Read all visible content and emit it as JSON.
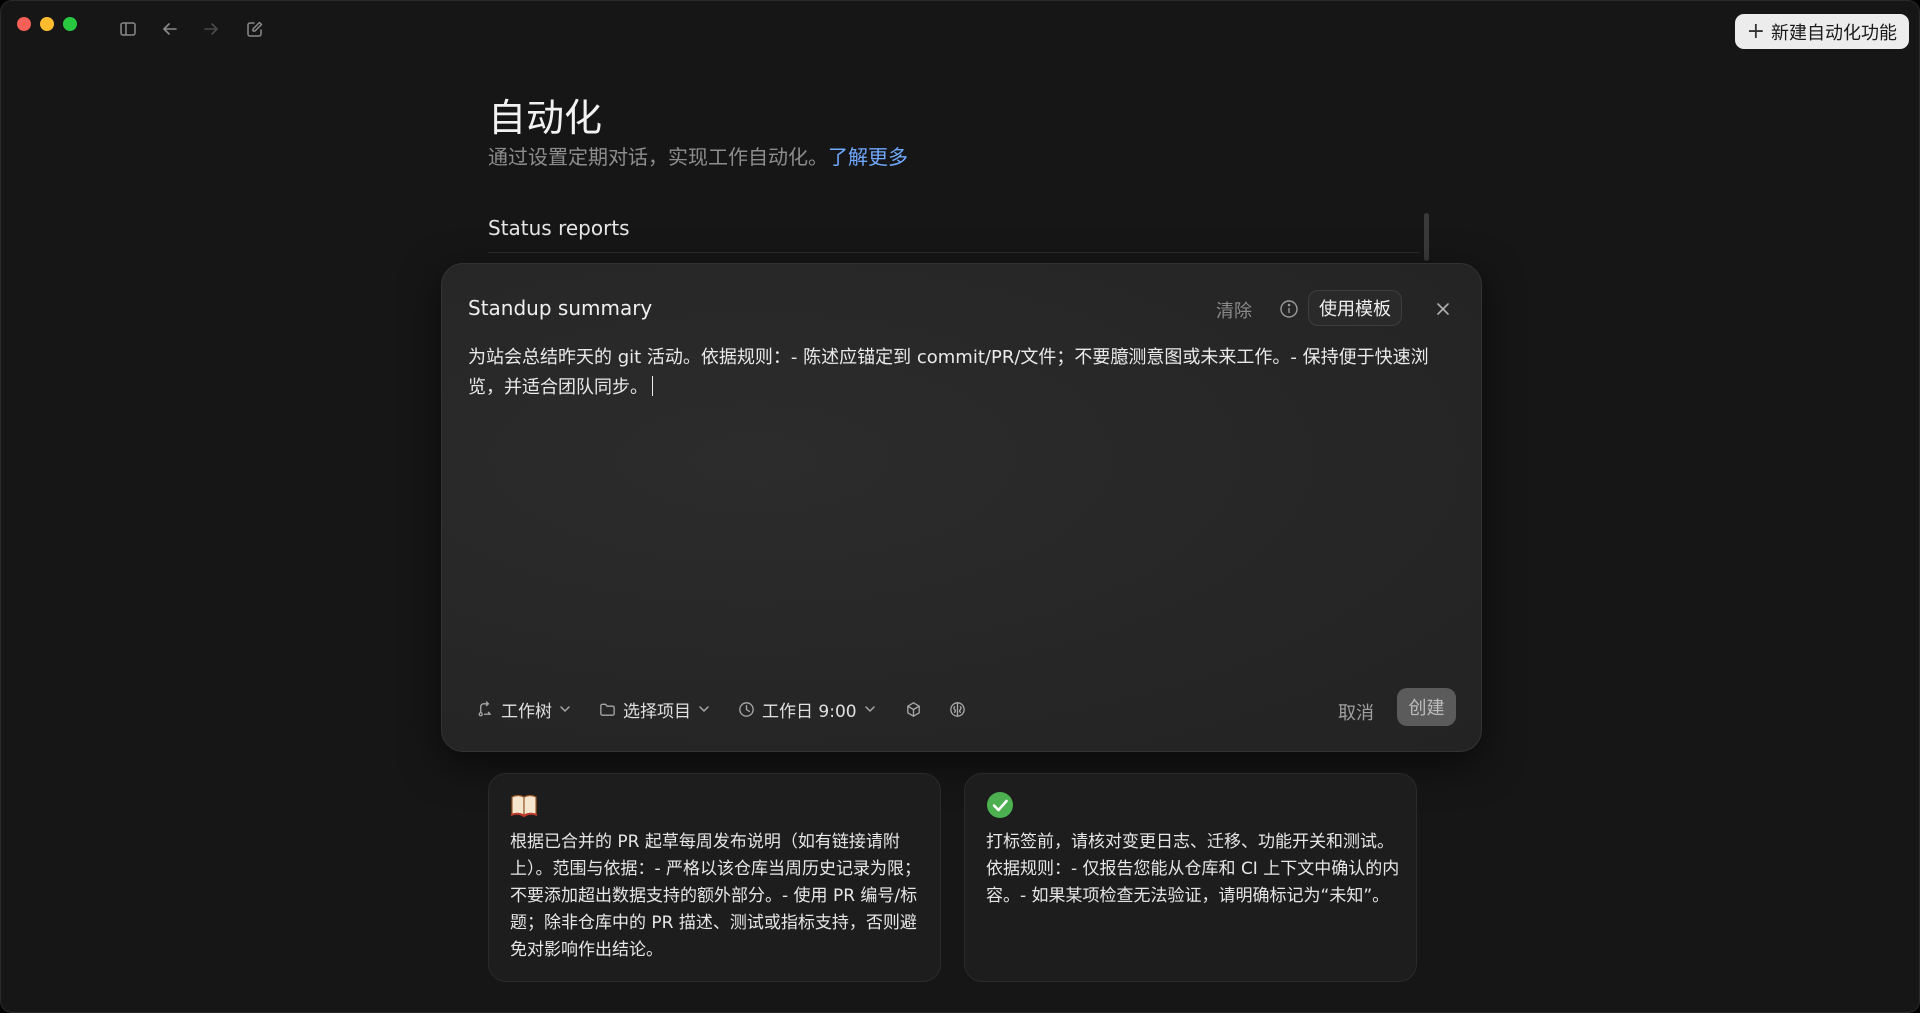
{
  "header": {
    "new_button_label": "新建自动化功能"
  },
  "page": {
    "title": "自动化",
    "subtitle": "通过设置定期对话，实现工作自动化。",
    "learn_more": "了解更多"
  },
  "list": {
    "section_label": "Status reports"
  },
  "editor": {
    "title": "Standup summary",
    "clear_label": "清除",
    "template_label": "使用模板",
    "body": "为站会总结昨天的 git 活动。依据规则：- 陈述应锚定到 commit/PR/文件；不要臆测意图或未来工作。- 保持便于快速浏览，并适合团队同步。",
    "footer": {
      "worktree": "工作树",
      "project": "选择项目",
      "schedule": "工作日 9:00",
      "cancel": "取消",
      "create": "创建"
    }
  },
  "cards": [
    {
      "icon": "open-book-icon",
      "text": "根据已合并的 PR 起草每周发布说明（如有链接请附上）。范围与依据：- 严格以该仓库当周历史记录为限；不要添加超出数据支持的额外部分。- 使用 PR 编号/标题；除非仓库中的 PR 描述、测试或指标支持，否则避免对影响作出结论。"
    },
    {
      "icon": "check-circle-icon",
      "text": "打标签前，请核对变更日志、迁移、功能开关和测试。依据规则：- 仅报告您能从仓库和 CI 上下文中确认的内容。- 如果某项检查无法验证，请明确标记为“未知”。"
    }
  ],
  "colors": {
    "background": "#161616",
    "accent_link": "#6fa8ff",
    "success": "#4caf50"
  }
}
